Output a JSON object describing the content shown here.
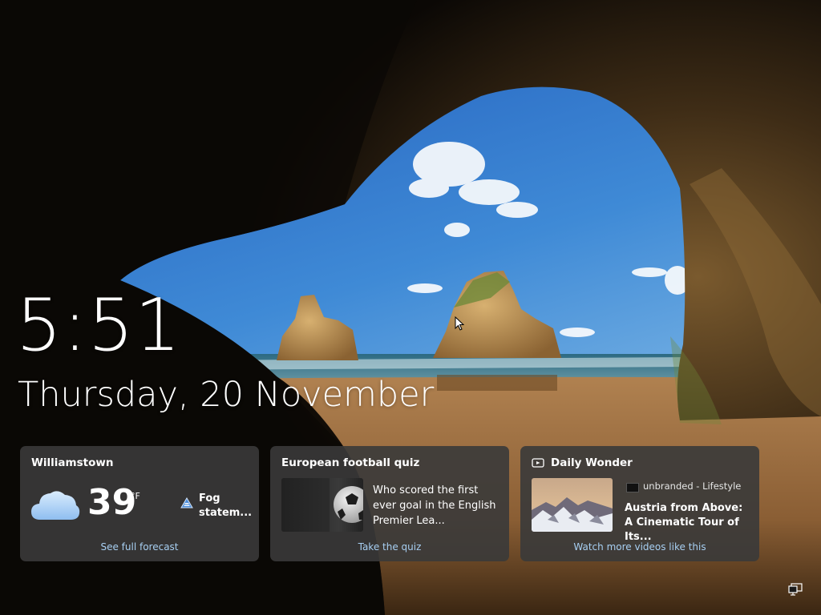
{
  "lockscreen": {
    "time": "5:51",
    "date": "Thursday, 20 November"
  },
  "weather": {
    "location": "Williamstown",
    "icon": "cloud-icon",
    "temperature": "39",
    "unit": "°F",
    "alert_icon": "warning-icon",
    "alert": "Fog statem...",
    "link": "See full forecast"
  },
  "quiz": {
    "title": "European football quiz",
    "image": "soccer-ball",
    "question": "Who scored the first ever goal in the English Premier Lea...",
    "link": "Take the quiz"
  },
  "daily_wonder": {
    "title": "Daily Wonder",
    "icon": "video-icon",
    "image": "snowy-mountains",
    "source": "unbranded - Lifestyle",
    "headline": "Austria from Above: A Cinematic Tour of Its...",
    "link": "Watch more videos like this"
  },
  "system_tray": {
    "network_icon": "network-icon"
  },
  "colors": {
    "card_bg": "#3a3a3a",
    "link": "#a7cff2",
    "text": "#ffffff"
  }
}
